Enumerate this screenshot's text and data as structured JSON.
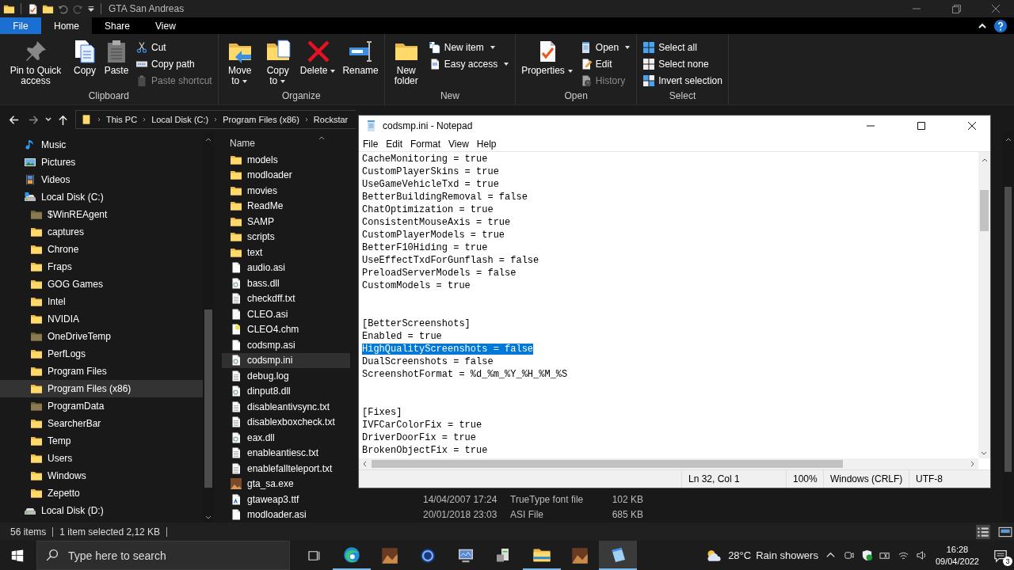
{
  "explorer": {
    "title": "GTA San Andreas",
    "ribbon_tabs": [
      {
        "label": "File",
        "kind": "file",
        "selected": false
      },
      {
        "label": "Home",
        "kind": "tab",
        "selected": true
      },
      {
        "label": "Share",
        "kind": "tab",
        "selected": false
      },
      {
        "label": "View",
        "kind": "tab",
        "selected": false
      }
    ],
    "ribbon_groups": [
      {
        "title": "Clipboard",
        "big": [
          {
            "label": "Pin to Quick access",
            "kind": "pin",
            "dropdown": false
          },
          {
            "label": "Copy",
            "kind": "copy",
            "dropdown": false
          },
          {
            "label": "Paste",
            "kind": "paste",
            "dropdown": false
          }
        ],
        "small": [
          {
            "label": "Cut",
            "kind": "cut",
            "dropdown": false,
            "disabled": false
          },
          {
            "label": "Copy path",
            "kind": "copypath",
            "dropdown": false,
            "disabled": false
          },
          {
            "label": "Paste shortcut",
            "kind": "pasteshortcut",
            "dropdown": false,
            "disabled": true
          }
        ]
      },
      {
        "title": "Organize",
        "big": [
          {
            "label": "Move to",
            "kind": "move",
            "dropdown": true
          },
          {
            "label": "Copy to",
            "kind": "copyto",
            "dropdown": true
          },
          {
            "label": "Delete",
            "kind": "delete",
            "dropdown": true
          },
          {
            "label": "Rename",
            "kind": "rename",
            "dropdown": false
          }
        ]
      },
      {
        "title": "New",
        "big": [
          {
            "label": "New folder",
            "kind": "newfolder",
            "dropdown": false
          }
        ],
        "small": [
          {
            "label": "New item",
            "kind": "newitem",
            "dropdown": true,
            "disabled": false
          },
          {
            "label": "Easy access",
            "kind": "easyaccess",
            "dropdown": true,
            "disabled": false
          }
        ]
      },
      {
        "title": "Open",
        "big": [
          {
            "label": "Properties",
            "kind": "properties",
            "dropdown": true
          }
        ],
        "small": [
          {
            "label": "Open",
            "kind": "open",
            "dropdown": true,
            "disabled": false
          },
          {
            "label": "Edit",
            "kind": "edit",
            "dropdown": false,
            "disabled": false
          },
          {
            "label": "History",
            "kind": "history",
            "dropdown": false,
            "disabled": true
          }
        ]
      },
      {
        "title": "Select",
        "small": [
          {
            "label": "Select all",
            "kind": "selectall",
            "dropdown": false,
            "disabled": false
          },
          {
            "label": "Select none",
            "kind": "selectnone",
            "dropdown": false,
            "disabled": false
          },
          {
            "label": "Invert selection",
            "kind": "invert",
            "dropdown": false,
            "disabled": false
          }
        ]
      }
    ],
    "address": [
      "This PC",
      "Local Disk (C:)",
      "Program Files (x86)",
      "Rockstar"
    ],
    "nav": [
      {
        "label": "Music",
        "kind": "music",
        "selected": false
      },
      {
        "label": "Pictures",
        "kind": "pictures",
        "selected": false
      },
      {
        "label": "Videos",
        "kind": "videos",
        "selected": false
      },
      {
        "label": "Local Disk (C:)",
        "kind": "drive",
        "selected": false,
        "children": [
          {
            "label": "$WinREAgent",
            "kind": "folder",
            "hidden": true,
            "selected": false
          },
          {
            "label": "captures",
            "kind": "folder",
            "hidden": false,
            "selected": false
          },
          {
            "label": "Chrone",
            "kind": "folder",
            "hidden": false,
            "selected": false
          },
          {
            "label": "Fraps",
            "kind": "folder",
            "hidden": false,
            "selected": false
          },
          {
            "label": "GOG Games",
            "kind": "folder",
            "hidden": false,
            "selected": false
          },
          {
            "label": "Intel",
            "kind": "folder",
            "hidden": false,
            "selected": false
          },
          {
            "label": "NVIDIA",
            "kind": "folder",
            "hidden": false,
            "selected": false
          },
          {
            "label": "OneDriveTemp",
            "kind": "folder",
            "hidden": true,
            "selected": false
          },
          {
            "label": "PerfLogs",
            "kind": "folder",
            "hidden": false,
            "selected": false
          },
          {
            "label": "Program Files",
            "kind": "folder",
            "hidden": false,
            "selected": false
          },
          {
            "label": "Program Files (x86)",
            "kind": "folder",
            "hidden": false,
            "selected": true
          },
          {
            "label": "ProgramData",
            "kind": "folder",
            "hidden": true,
            "selected": false
          },
          {
            "label": "SearcherBar",
            "kind": "folder",
            "hidden": false,
            "selected": false
          },
          {
            "label": "Temp",
            "kind": "folder",
            "hidden": false,
            "selected": false
          },
          {
            "label": "Users",
            "kind": "folder",
            "hidden": false,
            "selected": false
          },
          {
            "label": "Windows",
            "kind": "folder",
            "hidden": false,
            "selected": false
          },
          {
            "label": "Zepetto",
            "kind": "folder",
            "hidden": false,
            "selected": false
          }
        ]
      },
      {
        "label": "Local Disk (D:)",
        "kind": "drive",
        "selected": false
      }
    ],
    "name_column": "Name",
    "files": [
      {
        "name": "models",
        "kind": "folder",
        "selected": false
      },
      {
        "name": "modloader",
        "kind": "folder",
        "selected": false
      },
      {
        "name": "movies",
        "kind": "folder",
        "selected": false
      },
      {
        "name": "ReadMe",
        "kind": "folder",
        "selected": false
      },
      {
        "name": "SAMP",
        "kind": "folder",
        "selected": false
      },
      {
        "name": "scripts",
        "kind": "folder",
        "selected": false
      },
      {
        "name": "text",
        "kind": "folder",
        "selected": false
      },
      {
        "name": "audio.asi",
        "kind": "file",
        "selected": false
      },
      {
        "name": "bass.dll",
        "kind": "dll",
        "selected": false
      },
      {
        "name": "checkdff.txt",
        "kind": "text",
        "selected": false
      },
      {
        "name": "CLEO.asi",
        "kind": "file",
        "selected": false
      },
      {
        "name": "CLEO4.chm",
        "kind": "help",
        "selected": false
      },
      {
        "name": "codsmp.asi",
        "kind": "file",
        "selected": false
      },
      {
        "name": "codsmp.ini",
        "kind": "dll",
        "selected": true
      },
      {
        "name": "debug.log",
        "kind": "text",
        "selected": false
      },
      {
        "name": "dinput8.dll",
        "kind": "dll",
        "selected": false
      },
      {
        "name": "disableantivsync.txt",
        "kind": "text",
        "selected": false
      },
      {
        "name": "disablexboxcheck.txt",
        "kind": "text",
        "selected": false
      },
      {
        "name": "eax.dll",
        "kind": "dll",
        "selected": false
      },
      {
        "name": "enableantiesc.txt",
        "kind": "text",
        "selected": false
      },
      {
        "name": "enablefallteleport.txt",
        "kind": "text",
        "selected": false
      },
      {
        "name": "gta_sa.exe",
        "kind": "exe",
        "selected": false
      },
      {
        "name": "gtaweap3.ttf",
        "kind": "font",
        "selected": false,
        "date": "14/04/2007 17:24",
        "type": "TrueType font file",
        "size": "102 KB"
      },
      {
        "name": "modloader.asi",
        "kind": "file",
        "selected": false,
        "date": "20/01/2018 23:03",
        "type": "ASI File",
        "size": "685 KB"
      }
    ],
    "status": {
      "count": "56 items",
      "selection": "1 item selected  2,12 KB"
    }
  },
  "notepad": {
    "title": "codsmp.ini - Notepad",
    "menu": [
      "File",
      "Edit",
      "Format",
      "View",
      "Help"
    ],
    "blocks": [
      {
        "lines": [
          {
            "text": "CacheMonitoring = true",
            "selected": false
          },
          {
            "text": "CustomPlayerSkins = true",
            "selected": false
          },
          {
            "text": "UseGameVehicleTxd = true",
            "selected": false
          },
          {
            "text": "BetterBuildingRemoval = false",
            "selected": false
          },
          {
            "text": "ChatOptimization = true",
            "selected": false
          },
          {
            "text": "ConsistentMouseAxis = true",
            "selected": false
          },
          {
            "text": "CustomPlayerModels = true",
            "selected": false
          },
          {
            "text": "BetterF10Hiding = true",
            "selected": false
          },
          {
            "text": "UseEffectTxdForGunflash = false",
            "selected": false
          },
          {
            "text": "PreloadServerModels = false",
            "selected": false
          },
          {
            "text": "CustomModels = true",
            "selected": false
          }
        ]
      },
      {
        "lines": [
          {
            "text": "[BetterScreenshots]",
            "selected": false
          },
          {
            "text": "Enabled = true",
            "selected": false
          },
          {
            "text": "HighQualityScreenshots = false",
            "selected": true
          },
          {
            "text": "DualScreenshots = false",
            "selected": false
          },
          {
            "text": "ScreenshotFormat = %d_%m_%Y_%H_%M_%S",
            "selected": false
          }
        ]
      },
      {
        "lines": [
          {
            "text": "[Fixes]",
            "selected": false
          },
          {
            "text": "IVFCarColorFix = true",
            "selected": false
          },
          {
            "text": "DriverDoorFix = true",
            "selected": false
          },
          {
            "text": "BrokenObjectFix = true",
            "selected": false
          }
        ]
      }
    ],
    "status": [
      "Ln 32, Col 1",
      "100%",
      "Windows (CRLF)",
      "UTF-8"
    ]
  },
  "taskbar": {
    "search_placeholder": "Type here to search",
    "apps": [
      {
        "kind": "edge",
        "running": true,
        "active": false
      },
      {
        "kind": "game",
        "running": false,
        "active": false
      },
      {
        "kind": "ring",
        "running": false,
        "active": false
      },
      {
        "kind": "monitor",
        "running": false,
        "active": false
      },
      {
        "kind": "computer",
        "running": false,
        "active": false
      },
      {
        "kind": "explorer",
        "running": true,
        "active": false
      },
      {
        "kind": "game",
        "running": false,
        "active": false
      },
      {
        "kind": "notepad",
        "running": true,
        "active": true
      }
    ],
    "weather": {
      "temp": "28°C",
      "text": "Rain showers"
    },
    "time": "16:28",
    "date": "09/04/2022",
    "notifications": "3"
  }
}
